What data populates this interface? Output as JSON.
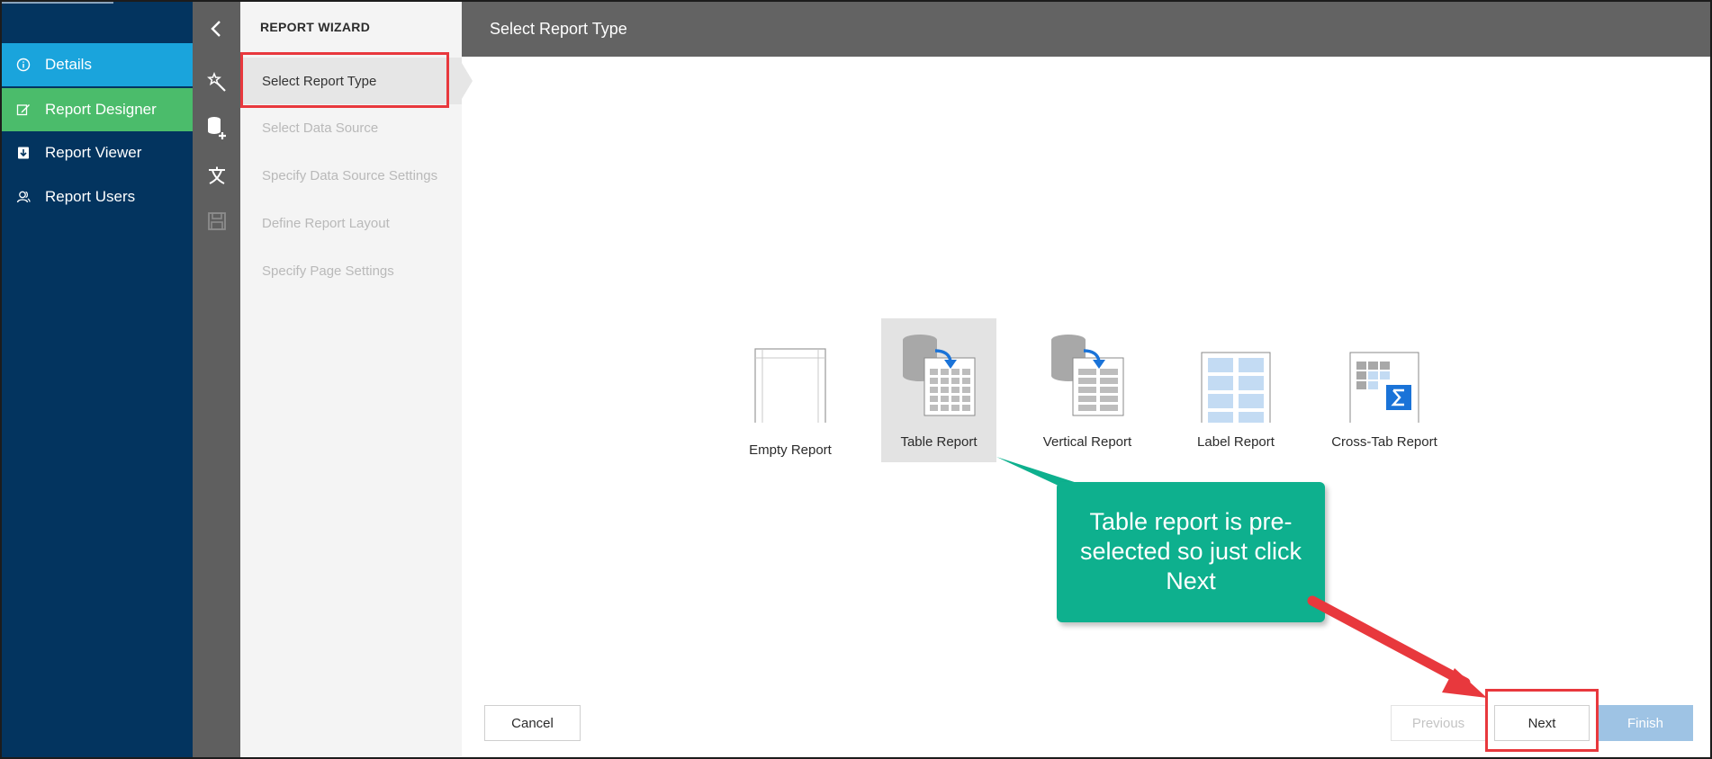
{
  "nav": {
    "items": [
      {
        "label": "Details",
        "icon": "info-icon"
      },
      {
        "label": "Report Designer",
        "icon": "edit-icon"
      },
      {
        "label": "Report Viewer",
        "icon": "viewer-icon"
      },
      {
        "label": "Report Users",
        "icon": "users-icon"
      }
    ]
  },
  "toolbar": {
    "icons": [
      "back-icon",
      "magic-wand-icon",
      "add-datasource-icon",
      "localization-icon",
      "save-icon"
    ]
  },
  "wizard": {
    "heading": "REPORT WIZARD",
    "steps": [
      {
        "label": "Select Report Type",
        "active": true
      },
      {
        "label": "Select Data Source",
        "active": false
      },
      {
        "label": "Specify Data Source Settings",
        "active": false
      },
      {
        "label": "Define Report Layout",
        "active": false
      },
      {
        "label": "Specify Page Settings",
        "active": false
      }
    ]
  },
  "main": {
    "title": "Select Report Type",
    "report_types": [
      {
        "label": "Empty Report",
        "selected": false
      },
      {
        "label": "Table Report",
        "selected": true
      },
      {
        "label": "Vertical Report",
        "selected": false
      },
      {
        "label": "Label Report",
        "selected": false
      },
      {
        "label": "Cross-Tab Report",
        "selected": false
      }
    ]
  },
  "annotation": {
    "callout_text": "Table report is pre-selected so just click Next",
    "color": "#0eb08e",
    "highlight_color": "#e8383d"
  },
  "footer": {
    "cancel": "Cancel",
    "previous": "Previous",
    "next": "Next",
    "finish": "Finish"
  },
  "colors": {
    "nav_bg": "#03345f",
    "details_bg": "#1aa4dc",
    "designer_bg": "#4bbc6b",
    "header_bg": "#636363"
  }
}
